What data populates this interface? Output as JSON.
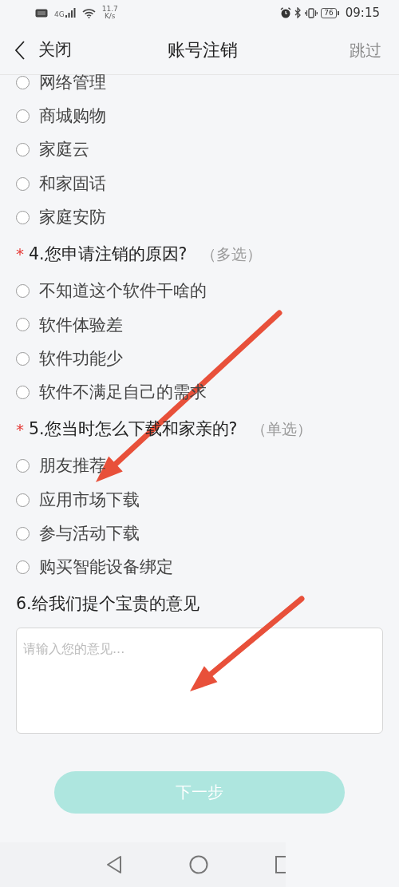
{
  "status_bar": {
    "network_type": "4G",
    "network_speed": "11.7",
    "speed_unit": "K/s",
    "battery": "76",
    "time": "09:15"
  },
  "header": {
    "back_label": "关闭",
    "title": "账号注销",
    "skip": "跳过"
  },
  "questions": [
    {
      "kind": "choice",
      "options": [
        {
          "label": "网络管理",
          "selected": false
        },
        {
          "label": "商城购物",
          "selected": false
        },
        {
          "label": "家庭云",
          "selected": false
        },
        {
          "label": "和家固话",
          "selected": false
        },
        {
          "label": "家庭安防",
          "selected": false
        }
      ]
    },
    {
      "kind": "choice",
      "required_mark": "*",
      "title": "4.您申请注销的原因?",
      "note": "（多选）",
      "options": [
        {
          "label": "不知道这个软件干啥的",
          "selected": false
        },
        {
          "label": "软件体验差",
          "selected": false
        },
        {
          "label": "软件功能少",
          "selected": false
        },
        {
          "label": "软件不满足自己的需求",
          "selected": false
        }
      ]
    },
    {
      "kind": "choice",
      "required_mark": "*",
      "title": "5.您当时怎么下载和家亲的?",
      "note": "（单选）",
      "options": [
        {
          "label": "朋友推荐",
          "selected": false
        },
        {
          "label": "应用市场下载",
          "selected": false
        },
        {
          "label": "参与活动下载",
          "selected": false
        },
        {
          "label": "购买智能设备绑定",
          "selected": false
        }
      ]
    },
    {
      "kind": "text",
      "title": "6.给我们提个宝贵的意见",
      "placeholder": "请输入您的意见..."
    }
  ],
  "next_button": {
    "label": "下一步",
    "disabled": true
  },
  "annotations": [
    {
      "kind": "arrow"
    },
    {
      "kind": "arrow"
    }
  ]
}
